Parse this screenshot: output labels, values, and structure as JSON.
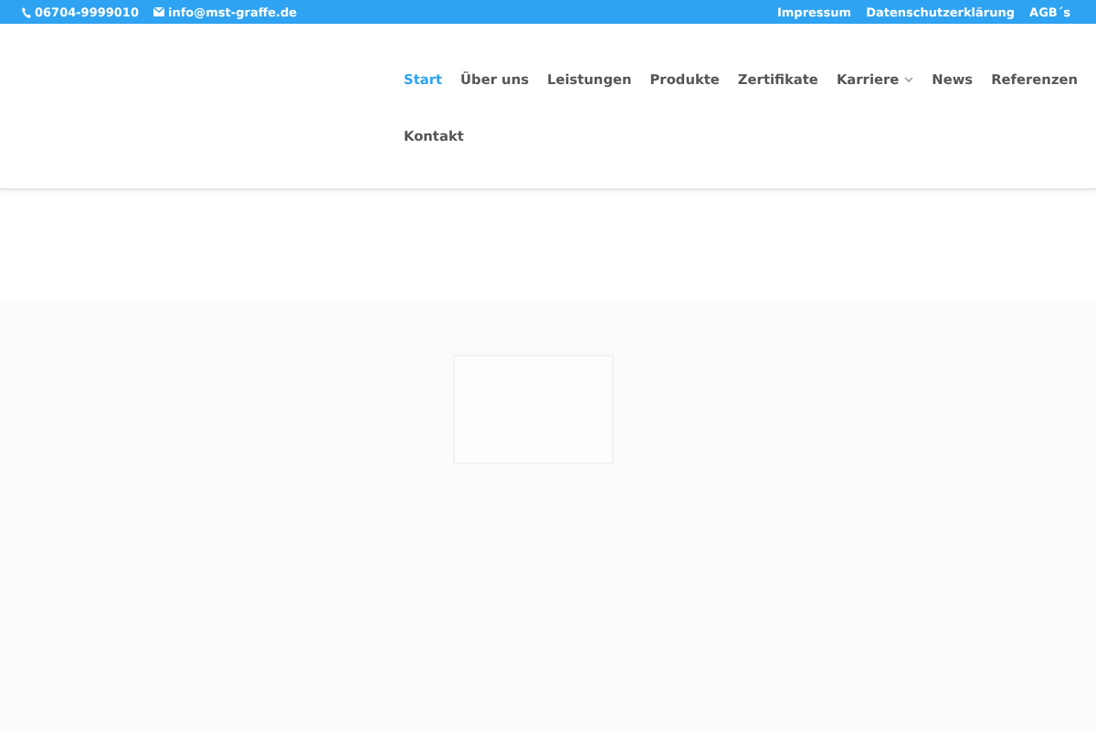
{
  "top_bar": {
    "phone": "06704-9999010",
    "email": "info@mst-graffe.de",
    "links": [
      "Impressum",
      "Datenschutzerklärung",
      "AGB´s"
    ]
  },
  "nav": {
    "items": [
      {
        "label": "Start",
        "selected": true,
        "has_submenu": false
      },
      {
        "label": "Über uns",
        "selected": false,
        "has_submenu": false
      },
      {
        "label": "Leistungen",
        "selected": false,
        "has_submenu": false
      },
      {
        "label": "Produkte",
        "selected": false,
        "has_submenu": false
      },
      {
        "label": "Zertifikate",
        "selected": false,
        "has_submenu": false
      },
      {
        "label": "Karriere",
        "selected": false,
        "has_submenu": true
      },
      {
        "label": "News",
        "selected": false,
        "has_submenu": false
      },
      {
        "label": "Referenzen",
        "selected": false,
        "has_submenu": false
      },
      {
        "label": "Kontakt",
        "selected": false,
        "has_submenu": false
      }
    ]
  }
}
